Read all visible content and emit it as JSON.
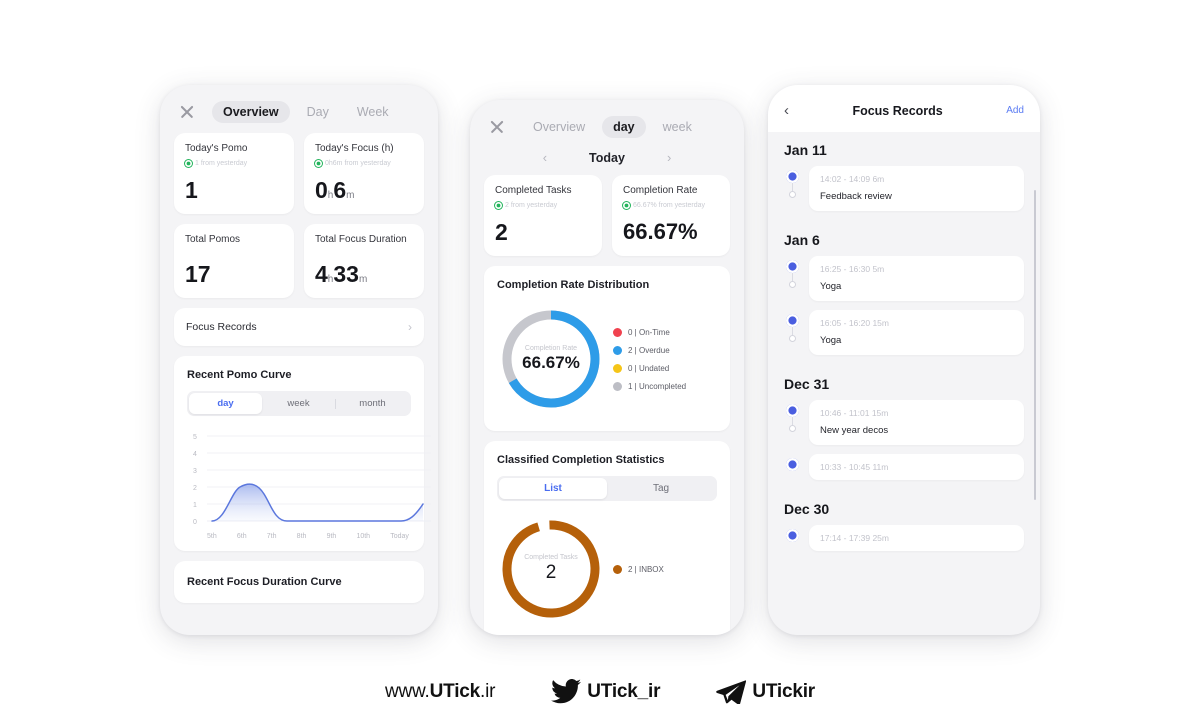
{
  "colors": {
    "accent_blue": "#4a6df0",
    "donut_blue": "#2e9ce8",
    "donut_gray": "#c6c7cd",
    "legend_red": "#f0424f",
    "legend_yellow": "#f5c518",
    "legend_gray": "#bdbec5",
    "orange": "#b5600a",
    "green": "#23b45c",
    "node_blue": "#4a5ee0",
    "link_blue": "#5b7cf3"
  },
  "phone1": {
    "tabs": [
      {
        "label": "Overview",
        "active": true
      },
      {
        "label": "Day",
        "active": false
      },
      {
        "label": "Week",
        "active": false
      }
    ],
    "close_icon": "close-icon",
    "stats": [
      {
        "title": "Today's Pomo",
        "delta": "1 from yesterday",
        "value": "1",
        "unit1": "",
        "value2": "",
        "unit2": ""
      },
      {
        "title": "Today's Focus (h)",
        "delta": "0h6m from yesterday",
        "value": "0",
        "unit1": "h",
        "value2": "6",
        "unit2": "m"
      },
      {
        "title": "Total Pomos",
        "delta": "",
        "value": "17",
        "unit1": "",
        "value2": "",
        "unit2": ""
      },
      {
        "title": "Total Focus Duration",
        "delta": "",
        "value": "4",
        "unit1": "h",
        "value2": "33",
        "unit2": "m"
      }
    ],
    "focus_records_row": "Focus Records",
    "pomo_curve": {
      "title": "Recent Pomo Curve",
      "segments": [
        {
          "label": "day",
          "active": true
        },
        {
          "label": "week",
          "active": false
        },
        {
          "label": "month",
          "active": false
        }
      ]
    },
    "focus_duration_curve_title": "Recent Focus Duration Curve"
  },
  "phone2": {
    "tabs": [
      {
        "label": "Overview",
        "active": false
      },
      {
        "label": "day",
        "active": true
      },
      {
        "label": "week",
        "active": false
      }
    ],
    "datenav": {
      "prev": "‹",
      "label": "Today",
      "next": "›"
    },
    "stats": [
      {
        "title": "Completed Tasks",
        "delta": "2 from yesterday",
        "value": "2"
      },
      {
        "title": "Completion Rate",
        "delta": "66.67% from yesterday",
        "value": "66.67%"
      }
    ],
    "distribution": {
      "title": "Completion Rate Distribution",
      "center_caption": "Completion Rate",
      "center_value": "66.67%"
    },
    "classified": {
      "title": "Classified Completion Statistics",
      "segments": [
        {
          "label": "List",
          "active": true
        },
        {
          "label": "Tag",
          "active": false
        }
      ],
      "center_caption": "Completed Tasks",
      "center_value": "2",
      "legend": [
        {
          "text": "2 | INBOX",
          "color": "#b5600a"
        }
      ]
    }
  },
  "phone3": {
    "back_icon": "chevron-left-icon",
    "title": "Focus Records",
    "add_label": "Add",
    "groups": [
      {
        "date": "Jan 11",
        "records": [
          {
            "time": "14:02 - 14:09  6m",
            "name": "Feedback review"
          }
        ]
      },
      {
        "date": "Jan 6",
        "records": [
          {
            "time": "16:25 - 16:30  5m",
            "name": "Yoga"
          },
          {
            "time": "16:05 - 16:20  15m",
            "name": "Yoga"
          }
        ]
      },
      {
        "date": "Dec 31",
        "records": [
          {
            "time": "10:46 - 11:01  15m",
            "name": "New year decos"
          },
          {
            "time": "10:33 - 10:45  11m",
            "name": ""
          }
        ]
      },
      {
        "date": "Dec 30",
        "records": [
          {
            "time": "17:14 - 17:39  25m",
            "name": ""
          }
        ]
      }
    ]
  },
  "footer": {
    "website": {
      "prefix": "www.",
      "brand": "UTick",
      "suffix": ".ir"
    },
    "twitter": {
      "icon": "twitter-icon",
      "handle": "UTick_ir"
    },
    "telegram": {
      "icon": "telegram-icon",
      "handle": "UTickir"
    }
  },
  "chart_data": [
    {
      "type": "area",
      "title": "Recent Pomo Curve",
      "categories": [
        "5th",
        "6th",
        "7th",
        "8th",
        "9th",
        "10th",
        "Today"
      ],
      "values": [
        0,
        2,
        0,
        0,
        0,
        0,
        1
      ],
      "ylim": [
        0,
        5
      ],
      "yticks": [
        0,
        1,
        2,
        3,
        4,
        5
      ],
      "xlabel": "",
      "ylabel": "",
      "grid": true,
      "legend": "none",
      "line_color": "#5b77dd",
      "fill_color": "#aebcf0"
    },
    {
      "type": "pie",
      "title": "Completion Rate Distribution",
      "center_label": "Completion Rate",
      "center_value": "66.67%",
      "labels": [
        "On-Time",
        "Overdue",
        "Undated",
        "Uncompleted"
      ],
      "values": [
        0,
        2,
        0,
        1
      ],
      "colors": [
        "#f0424f",
        "#2e9ce8",
        "#f5c518",
        "#bdbec5"
      ],
      "legend_entries": [
        {
          "text": "0 | On-Time",
          "color": "#f0424f"
        },
        {
          "text": "2 | Overdue",
          "color": "#2e9ce8"
        },
        {
          "text": "0 | Undated",
          "color": "#f5c518"
        },
        {
          "text": "1 | Uncompleted",
          "color": "#bdbec5"
        }
      ],
      "legend_position": "right",
      "donut_fraction": 0.6667
    },
    {
      "type": "pie",
      "title": "Classified Completion Statistics",
      "center_label": "Completed Tasks",
      "center_value": "2",
      "labels": [
        "INBOX"
      ],
      "values": [
        2
      ],
      "colors": [
        "#b5600a"
      ],
      "legend_entries": [
        {
          "text": "2 | INBOX",
          "color": "#b5600a"
        }
      ],
      "legend_position": "right",
      "donut_fraction": 1.0
    }
  ]
}
